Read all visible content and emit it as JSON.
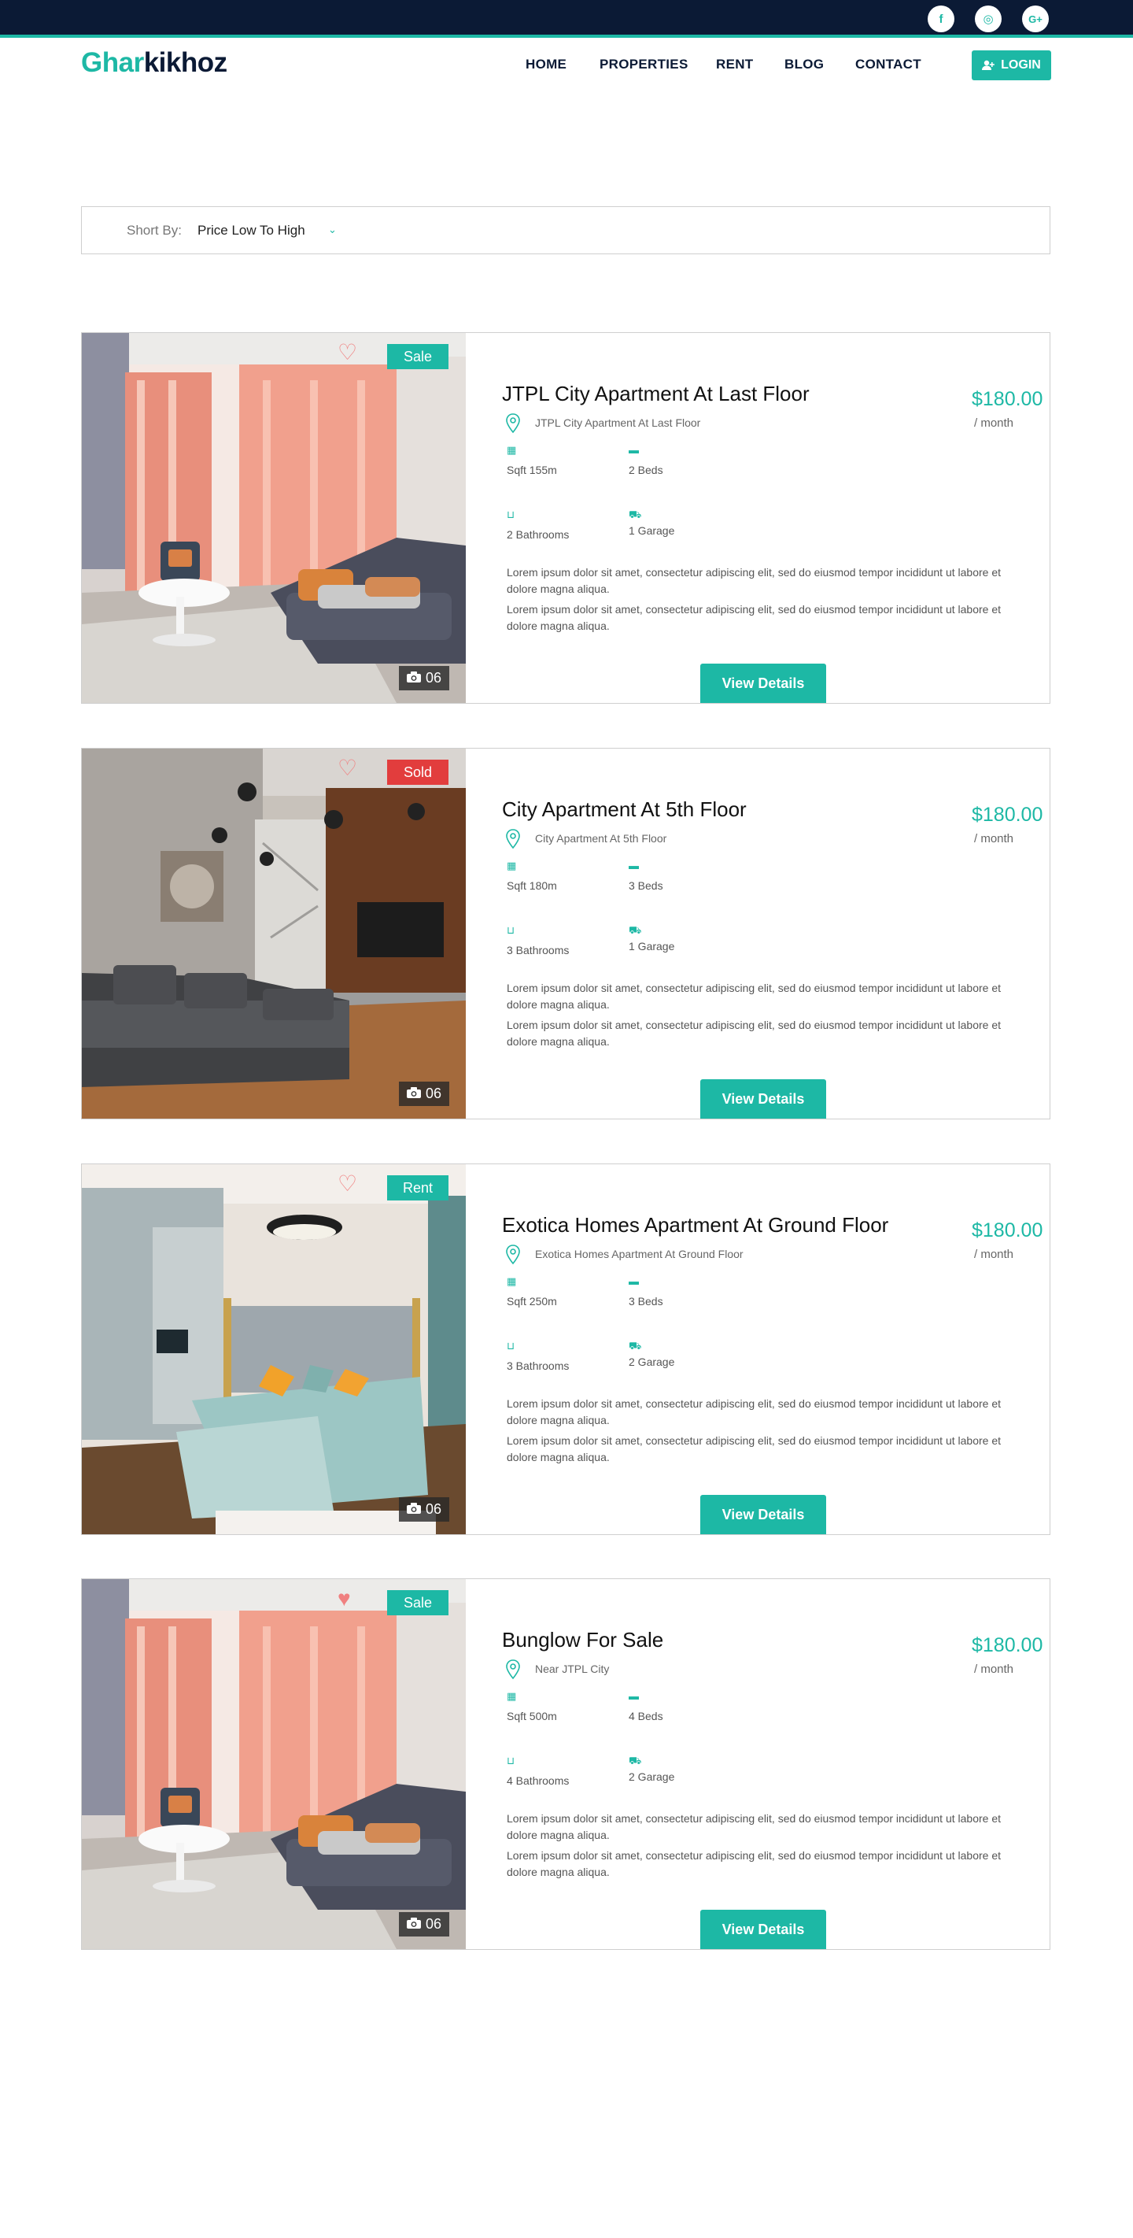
{
  "header": {
    "social": [
      "f",
      "◎",
      "G+"
    ],
    "logo_part1": "Ghar",
    "logo_part2": "kikhoz",
    "nav": [
      "HOME",
      "PROPERTIES",
      "RENT",
      "BLOG",
      "CONTACT"
    ],
    "login_label": "LOGIN"
  },
  "sort": {
    "label": "Short By:",
    "value": "Price Low To High"
  },
  "listings": [
    {
      "badge": "Sale",
      "badge_color": "#1db8a5",
      "fav": false,
      "photo": "living",
      "title": "JTPL City Apartment At Last Floor",
      "location": "JTPL City Apartment At Last Floor",
      "price": "$180.00",
      "period": "/ month",
      "area": "Sqft 155m",
      "beds": "2 Beds",
      "baths": "2 Bathrooms",
      "garage": "1 Garage",
      "desc1": "Lorem ipsum dolor sit amet, consectetur adipiscing elit, sed do eiusmod tempor incididunt ut labore et dolore magna aliqua.",
      "desc2": "Lorem ipsum dolor sit amet, consectetur adipiscing elit, sed do eiusmod tempor incididunt ut labore et dolore magna aliqua.",
      "photos": "06",
      "button": "View Details"
    },
    {
      "badge": "Sold",
      "badge_color": "#e23d3d",
      "fav": false,
      "photo": "lounge",
      "title": "City Apartment At 5th Floor",
      "location": "City Apartment At 5th Floor",
      "price": "$180.00",
      "period": "/ month",
      "area": "Sqft 180m",
      "beds": "3 Beds",
      "baths": "3 Bathrooms",
      "garage": "1 Garage",
      "desc1": "Lorem ipsum dolor sit amet, consectetur adipiscing elit, sed do eiusmod tempor incididunt ut labore et dolore magna aliqua.",
      "desc2": "Lorem ipsum dolor sit amet, consectetur adipiscing elit, sed do eiusmod tempor incididunt ut labore et dolore magna aliqua.",
      "photos": "06",
      "button": "View Details"
    },
    {
      "badge": "Rent",
      "badge_color": "#1db8a5",
      "fav": false,
      "photo": "bedroom",
      "title": "Exotica Homes Apartment At Ground Floor",
      "location": "Exotica Homes Apartment At Ground Floor",
      "price": "$180.00",
      "period": "/ month",
      "area": "Sqft 250m",
      "beds": "3 Beds",
      "baths": "3 Bathrooms",
      "garage": "2 Garage",
      "desc1": "Lorem ipsum dolor sit amet, consectetur adipiscing elit, sed do eiusmod tempor incididunt ut labore et dolore magna aliqua.",
      "desc2": "Lorem ipsum dolor sit amet, consectetur adipiscing elit, sed do eiusmod tempor incididunt ut labore et dolore magna aliqua.",
      "photos": "06",
      "button": "View Details"
    },
    {
      "badge": "Sale",
      "badge_color": "#1db8a5",
      "fav": true,
      "photo": "living",
      "title": "Bunglow For Sale",
      "location": "Near JTPL City",
      "price": "$180.00",
      "period": "/ month",
      "area": "Sqft 500m",
      "beds": "4 Beds",
      "baths": "4 Bathrooms",
      "garage": "2 Garage",
      "desc1": "Lorem ipsum dolor sit amet, consectetur adipiscing elit, sed do eiusmod tempor incididunt ut labore et dolore magna aliqua.",
      "desc2": "Lorem ipsum dolor sit amet, consectetur adipiscing elit, sed do eiusmod tempor incididunt ut labore et dolore magna aliqua.",
      "photos": "06",
      "button": "View Details"
    }
  ],
  "colors": {
    "accent": "#1db8a5",
    "dark": "#0b1a35",
    "sold": "#e23d3d",
    "heart": "#f08080"
  }
}
